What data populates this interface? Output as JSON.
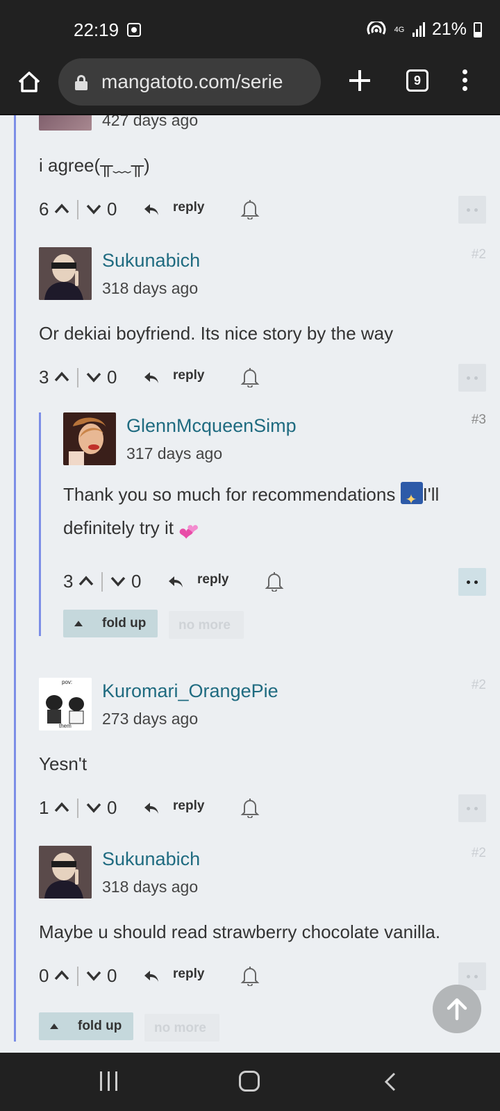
{
  "status_bar": {
    "time": "22:19",
    "network": "4G",
    "battery": "21%"
  },
  "browser": {
    "url": "mangatoto.com/serie",
    "tab_count": "9"
  },
  "comments": [
    {
      "timestamp": "427 days ago",
      "body": "i agree(╥﹏╥)",
      "upvotes": "6",
      "downvotes": "0",
      "reply_label": "reply"
    },
    {
      "username": "Sukunabich",
      "timestamp": "318 days ago",
      "number": "#2",
      "body": "Or dekiai boyfriend. Its nice story by the way",
      "upvotes": "3",
      "downvotes": "0",
      "reply_label": "reply"
    },
    {
      "username": "GlennMcqueenSimp",
      "timestamp": "317 days ago",
      "number": "#3",
      "body_part1": "Thank you so much for recommendations",
      "body_part2": "I'll",
      "body_part3": "definitely try it",
      "upvotes": "3",
      "downvotes": "0",
      "reply_label": "reply"
    },
    {
      "username": "Kuromari_OrangePie",
      "timestamp": "273 days ago",
      "number": "#2",
      "avatar_text_top": "pov:",
      "avatar_text_bottom": "them",
      "body": "Yesn't",
      "upvotes": "1",
      "downvotes": "0",
      "reply_label": "reply"
    },
    {
      "username": "Sukunabich",
      "timestamp": "318 days ago",
      "number": "#2",
      "body": "Maybe u should read strawberry chocolate vanilla.",
      "upvotes": "0",
      "downvotes": "0",
      "reply_label": "reply"
    }
  ],
  "fold": {
    "fold_up": "fold up",
    "no_more": "no more"
  },
  "colors": {
    "username": "#1f6b80",
    "thread_line": "#7c8ee6",
    "fold_button": "#c5d8dc"
  }
}
